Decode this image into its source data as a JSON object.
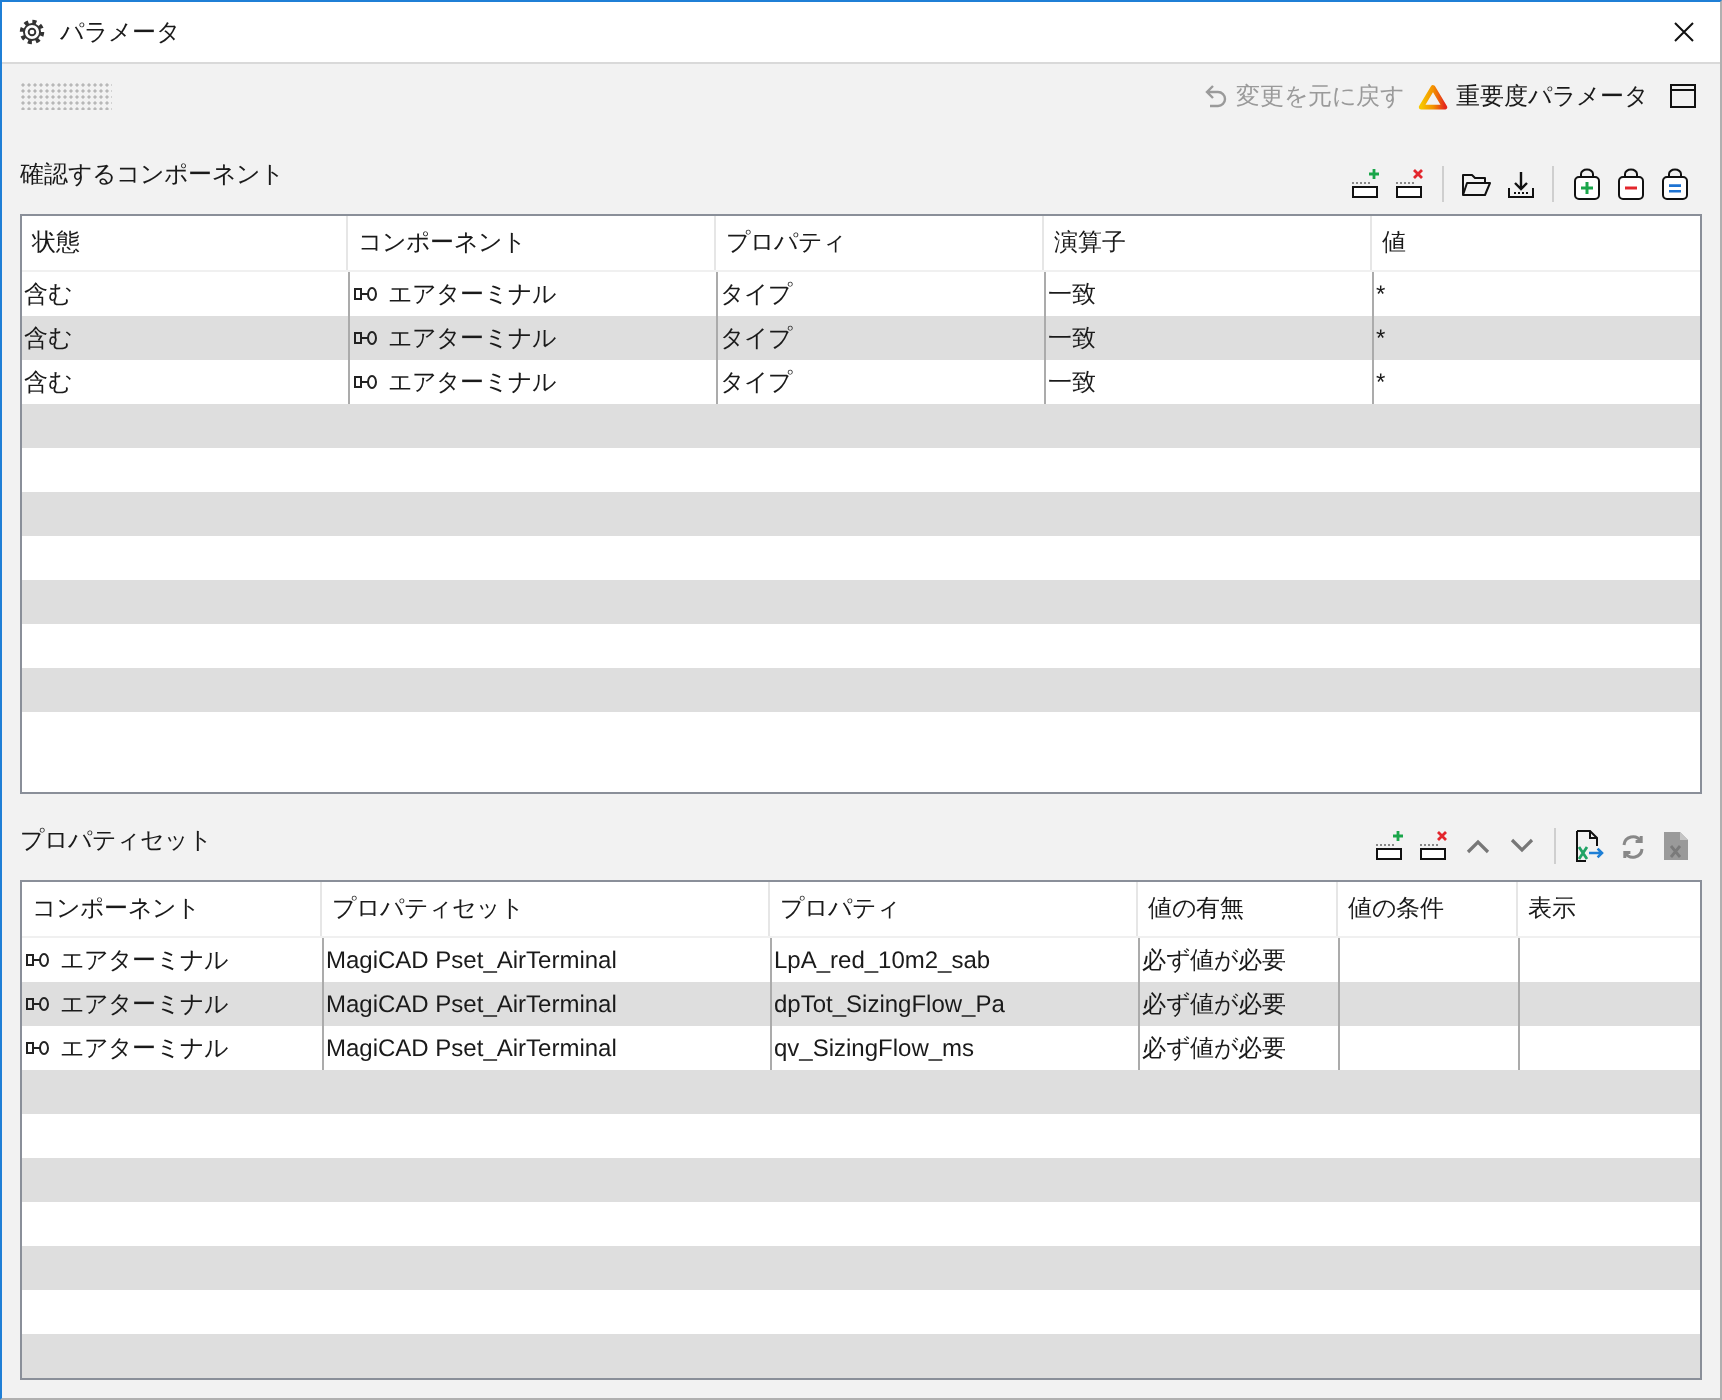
{
  "window": {
    "title": "パラメータ"
  },
  "toolbar": {
    "undo": {
      "label": "変更を元に戻す",
      "disabled": true
    },
    "important_parameters": {
      "label": "重要度パラメータ"
    }
  },
  "components": {
    "title": "確認するコンポーネント",
    "columns": [
      {
        "label": "状態",
        "kind": "text"
      },
      {
        "label": "コンポーネント",
        "kind": "component"
      },
      {
        "label": "プロパティ",
        "kind": "text"
      },
      {
        "label": "演算子",
        "kind": "text"
      },
      {
        "label": "値",
        "kind": "text"
      }
    ],
    "rows": [
      {
        "cells": [
          "含む",
          "エアターミナル",
          "タイプ",
          "一致",
          "*"
        ]
      },
      {
        "cells": [
          "含む",
          "エアターミナル",
          "タイプ",
          "一致",
          "*"
        ]
      },
      {
        "cells": [
          "含む",
          "エアターミナル",
          "タイプ",
          "一致",
          "*"
        ]
      }
    ]
  },
  "property_sets": {
    "title": "プロパティセット",
    "columns": [
      {
        "label": "コンポーネント",
        "kind": "component"
      },
      {
        "label": "プロパティセット",
        "kind": "text"
      },
      {
        "label": "プロパティ",
        "kind": "text"
      },
      {
        "label": "値の有無",
        "kind": "text"
      },
      {
        "label": "値の条件",
        "kind": "text"
      },
      {
        "label": "表示",
        "kind": "text"
      }
    ],
    "rows": [
      {
        "cells": [
          "エアターミナル",
          "MagiCAD Pset_AirTerminal",
          "LpA_red_10m2_sab",
          "必ず値が必要"
        ]
      },
      {
        "cells": [
          "エアターミナル",
          "MagiCAD Pset_AirTerminal",
          "dpTot_SizingFlow_Pa",
          "必ず値が必要"
        ]
      },
      {
        "cells": [
          "エアターミナル",
          "MagiCAD Pset_AirTerminal",
          "qv_SizingFlow_ms",
          "必ず値が必要"
        ]
      }
    ]
  }
}
